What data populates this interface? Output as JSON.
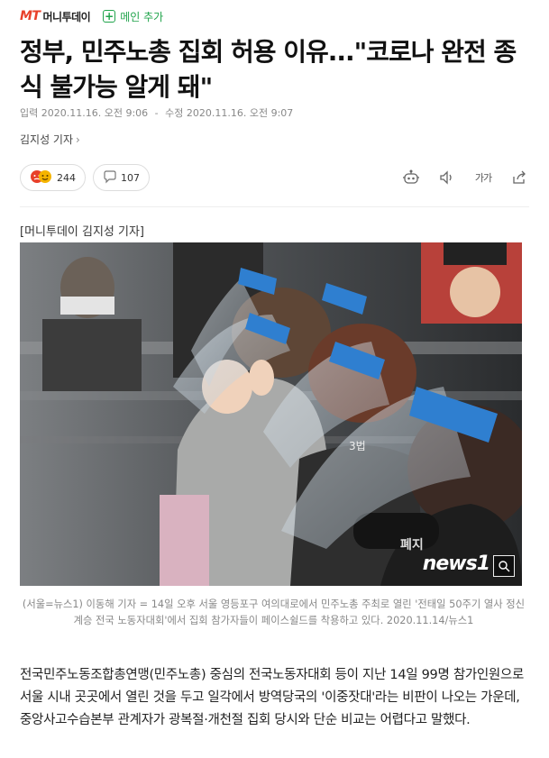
{
  "header": {
    "logo_mark": "MT",
    "logo_name": "머니투데이",
    "add_main_label": "메인 추가"
  },
  "article": {
    "title": "정부, 민주노총 집회 허용 이유...\"코로나 완전 종식 불가능 알게 돼\"",
    "input_time": "입력 2020.11.16. 오전 9:06",
    "separator": "-",
    "modified_time": "수정 2020.11.16. 오전 9:07",
    "author": "김지성 기자",
    "reaction_count": "244",
    "comment_count": "107",
    "photo_credit": "[머니투데이 김지성 기자]",
    "watermark": "news1",
    "caption": "(서울=뉴스1) 이동해 기자 = 14일 오후 서울 영등포구 여의대로에서 민주노총 주최로 열린 '전태일 50주기 열사 정신 계승 전국 노동자대회'에서 집회 참가자들이 페이스쉴드를 착용하고 있다. 2020.11.14/뉴스1",
    "body": "전국민주노동조합총연맹(민주노총) 중심의 전국노동자대회 등이 지난 14일 99명 참가인원으로 서울 시내 곳곳에서 열린 것을 두고 일각에서 방역당국의 '이중잣대'라는 비판이 나오는 가운데, 중앙사고수습본부 관계자가 광복절·개천절 집회 당시와 단순 비교는 어렵다고 말했다."
  },
  "toolbar": {
    "icons": [
      "robot-icon",
      "speaker-icon",
      "font-size-icon",
      "share-icon"
    ],
    "font_size_label": "가가"
  },
  "colors": {
    "brand": "#e8402a",
    "add_main": "#1fa34a",
    "shield_band": "#2f7fd0"
  }
}
